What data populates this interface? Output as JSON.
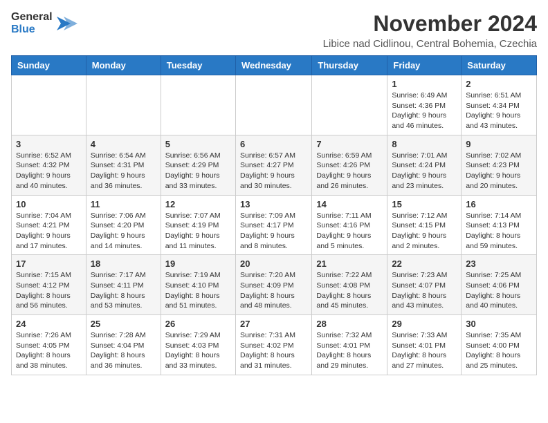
{
  "logo": {
    "line1": "General",
    "line2": "Blue"
  },
  "title": "November 2024",
  "subtitle": "Libice nad Cidlinou, Central Bohemia, Czechia",
  "weekdays": [
    "Sunday",
    "Monday",
    "Tuesday",
    "Wednesday",
    "Thursday",
    "Friday",
    "Saturday"
  ],
  "weeks": [
    [
      {
        "day": "",
        "info": ""
      },
      {
        "day": "",
        "info": ""
      },
      {
        "day": "",
        "info": ""
      },
      {
        "day": "",
        "info": ""
      },
      {
        "day": "",
        "info": ""
      },
      {
        "day": "1",
        "info": "Sunrise: 6:49 AM\nSunset: 4:36 PM\nDaylight: 9 hours and 46 minutes."
      },
      {
        "day": "2",
        "info": "Sunrise: 6:51 AM\nSunset: 4:34 PM\nDaylight: 9 hours and 43 minutes."
      }
    ],
    [
      {
        "day": "3",
        "info": "Sunrise: 6:52 AM\nSunset: 4:32 PM\nDaylight: 9 hours and 40 minutes."
      },
      {
        "day": "4",
        "info": "Sunrise: 6:54 AM\nSunset: 4:31 PM\nDaylight: 9 hours and 36 minutes."
      },
      {
        "day": "5",
        "info": "Sunrise: 6:56 AM\nSunset: 4:29 PM\nDaylight: 9 hours and 33 minutes."
      },
      {
        "day": "6",
        "info": "Sunrise: 6:57 AM\nSunset: 4:27 PM\nDaylight: 9 hours and 30 minutes."
      },
      {
        "day": "7",
        "info": "Sunrise: 6:59 AM\nSunset: 4:26 PM\nDaylight: 9 hours and 26 minutes."
      },
      {
        "day": "8",
        "info": "Sunrise: 7:01 AM\nSunset: 4:24 PM\nDaylight: 9 hours and 23 minutes."
      },
      {
        "day": "9",
        "info": "Sunrise: 7:02 AM\nSunset: 4:23 PM\nDaylight: 9 hours and 20 minutes."
      }
    ],
    [
      {
        "day": "10",
        "info": "Sunrise: 7:04 AM\nSunset: 4:21 PM\nDaylight: 9 hours and 17 minutes."
      },
      {
        "day": "11",
        "info": "Sunrise: 7:06 AM\nSunset: 4:20 PM\nDaylight: 9 hours and 14 minutes."
      },
      {
        "day": "12",
        "info": "Sunrise: 7:07 AM\nSunset: 4:19 PM\nDaylight: 9 hours and 11 minutes."
      },
      {
        "day": "13",
        "info": "Sunrise: 7:09 AM\nSunset: 4:17 PM\nDaylight: 9 hours and 8 minutes."
      },
      {
        "day": "14",
        "info": "Sunrise: 7:11 AM\nSunset: 4:16 PM\nDaylight: 9 hours and 5 minutes."
      },
      {
        "day": "15",
        "info": "Sunrise: 7:12 AM\nSunset: 4:15 PM\nDaylight: 9 hours and 2 minutes."
      },
      {
        "day": "16",
        "info": "Sunrise: 7:14 AM\nSunset: 4:13 PM\nDaylight: 8 hours and 59 minutes."
      }
    ],
    [
      {
        "day": "17",
        "info": "Sunrise: 7:15 AM\nSunset: 4:12 PM\nDaylight: 8 hours and 56 minutes."
      },
      {
        "day": "18",
        "info": "Sunrise: 7:17 AM\nSunset: 4:11 PM\nDaylight: 8 hours and 53 minutes."
      },
      {
        "day": "19",
        "info": "Sunrise: 7:19 AM\nSunset: 4:10 PM\nDaylight: 8 hours and 51 minutes."
      },
      {
        "day": "20",
        "info": "Sunrise: 7:20 AM\nSunset: 4:09 PM\nDaylight: 8 hours and 48 minutes."
      },
      {
        "day": "21",
        "info": "Sunrise: 7:22 AM\nSunset: 4:08 PM\nDaylight: 8 hours and 45 minutes."
      },
      {
        "day": "22",
        "info": "Sunrise: 7:23 AM\nSunset: 4:07 PM\nDaylight: 8 hours and 43 minutes."
      },
      {
        "day": "23",
        "info": "Sunrise: 7:25 AM\nSunset: 4:06 PM\nDaylight: 8 hours and 40 minutes."
      }
    ],
    [
      {
        "day": "24",
        "info": "Sunrise: 7:26 AM\nSunset: 4:05 PM\nDaylight: 8 hours and 38 minutes."
      },
      {
        "day": "25",
        "info": "Sunrise: 7:28 AM\nSunset: 4:04 PM\nDaylight: 8 hours and 36 minutes."
      },
      {
        "day": "26",
        "info": "Sunrise: 7:29 AM\nSunset: 4:03 PM\nDaylight: 8 hours and 33 minutes."
      },
      {
        "day": "27",
        "info": "Sunrise: 7:31 AM\nSunset: 4:02 PM\nDaylight: 8 hours and 31 minutes."
      },
      {
        "day": "28",
        "info": "Sunrise: 7:32 AM\nSunset: 4:01 PM\nDaylight: 8 hours and 29 minutes."
      },
      {
        "day": "29",
        "info": "Sunrise: 7:33 AM\nSunset: 4:01 PM\nDaylight: 8 hours and 27 minutes."
      },
      {
        "day": "30",
        "info": "Sunrise: 7:35 AM\nSunset: 4:00 PM\nDaylight: 8 hours and 25 minutes."
      }
    ]
  ]
}
